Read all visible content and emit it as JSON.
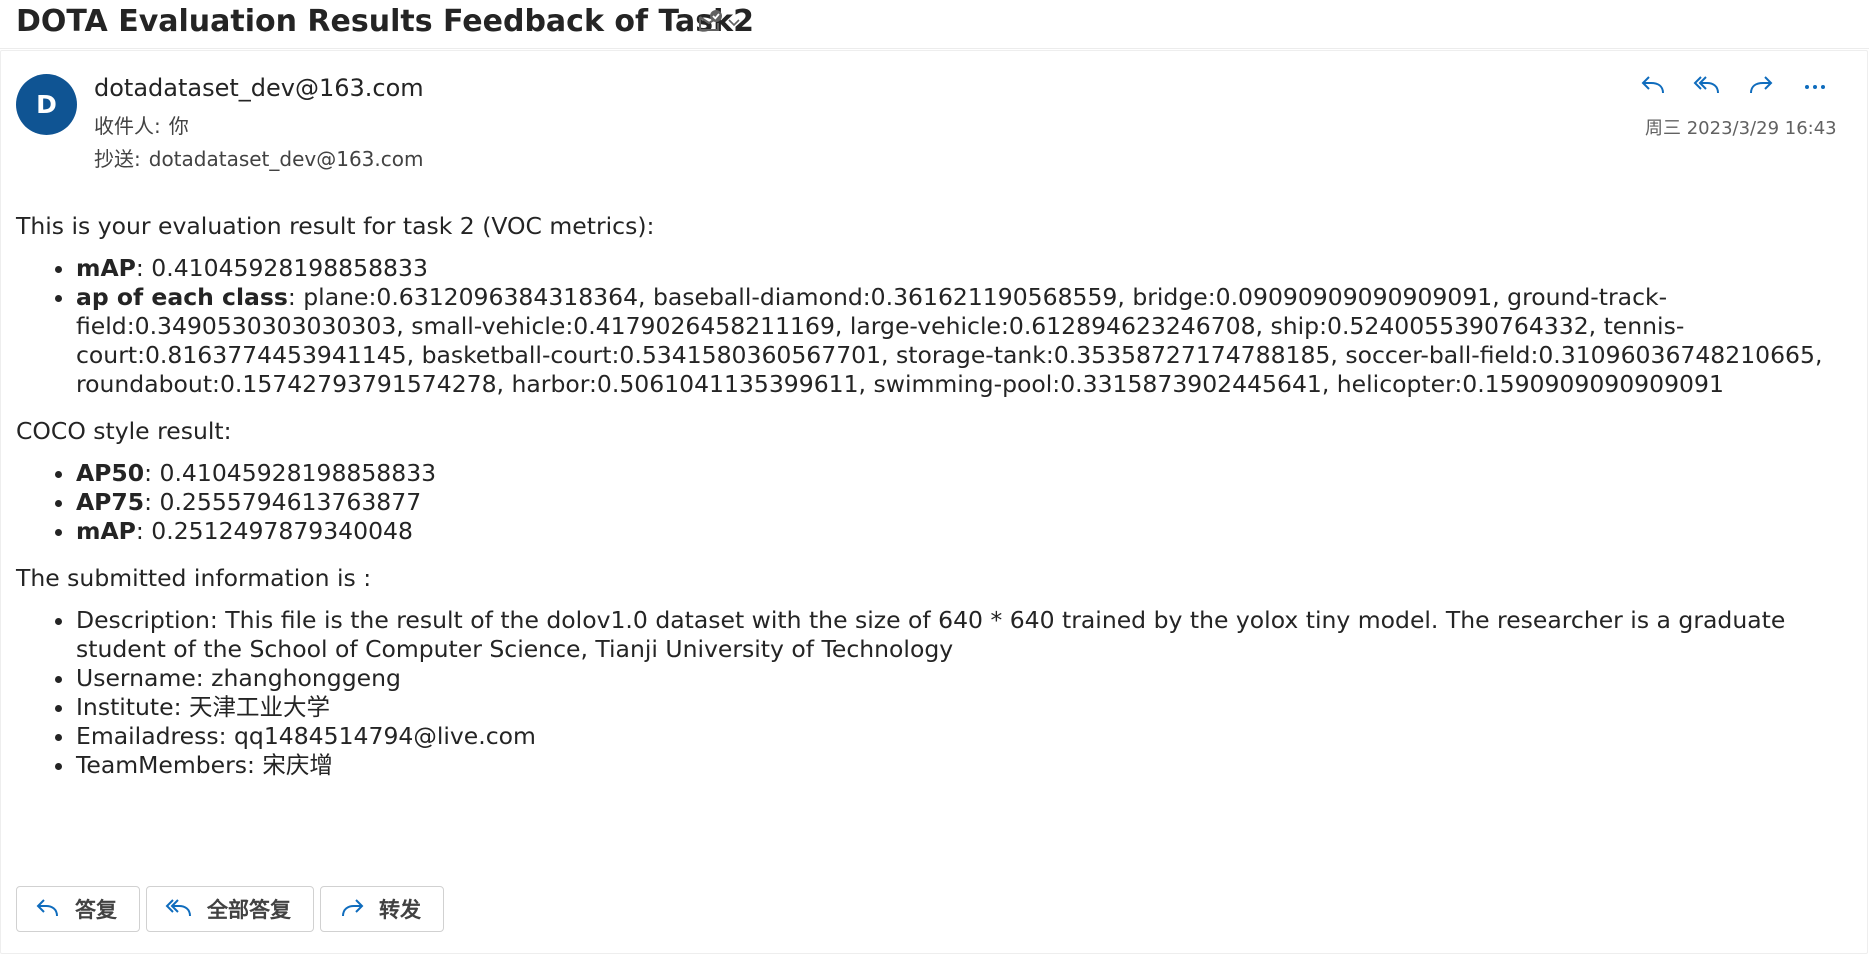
{
  "subject": "DOTA Evaluation Results Feedback of Task2",
  "icons": {
    "subject_action": "envelope-check-icon",
    "dropdown": "chevron-down-icon",
    "reply": "reply-icon",
    "reply_all": "reply-all-icon",
    "forward": "forward-icon",
    "more": "more-icon"
  },
  "colors": {
    "accent": "#0f6cbd",
    "avatar_bg": "#0f5493"
  },
  "header": {
    "avatar_initial": "D",
    "sender": "dotadataset_dev@163.com",
    "to_label": "收件人:",
    "to_value": "你",
    "cc_label": "抄送:",
    "cc_value": "dotadataset_dev@163.com",
    "date": "周三 2023/3/29 16:43"
  },
  "body": {
    "intro": "This is your evaluation result for task 2 (VOC metrics):",
    "voc": [
      {
        "label": "mAP",
        "value": ": 0.41045928198858833"
      },
      {
        "label": "ap of each class",
        "value": ": plane:0.6312096384318364, baseball-diamond:0.361621190568559, bridge:0.09090909090909091, ground-track-field:0.3490530303030303, small-vehicle:0.4179026458211169, large-vehicle:0.612894623246708, ship:0.5240055390764332, tennis-court:0.8163774453941145, basketball-court:0.5341580360567701, storage-tank:0.35358727174788185, soccer-ball-field:0.31096036748210665, roundabout:0.15742793791574278, harbor:0.5061041135399611, swimming-pool:0.3315873902445641, helicopter:0.1590909090909091"
      }
    ],
    "coco_intro": "COCO style result:",
    "coco": [
      {
        "label": "AP50",
        "value": ": 0.41045928198858833"
      },
      {
        "label": "AP75",
        "value": ": 0.2555794613763877"
      },
      {
        "label": "mAP",
        "value": ": 0.2512497879340048"
      }
    ],
    "submitted_intro": "The submitted information is :",
    "submitted": [
      "Description: This file is the result of the dolov1.0 dataset with the size of 640 * 640 trained by the yolox tiny model. The researcher is a graduate student of the School of Computer Science, Tianji University of Technology",
      "Username: zhanghonggeng",
      "Institute: 天津工业大学",
      "Emailadress: qq1484514794@live.com",
      "TeamMembers: 宋庆增"
    ]
  },
  "reply_bar": {
    "reply": "答复",
    "reply_all": "全部答复",
    "forward": "转发"
  }
}
